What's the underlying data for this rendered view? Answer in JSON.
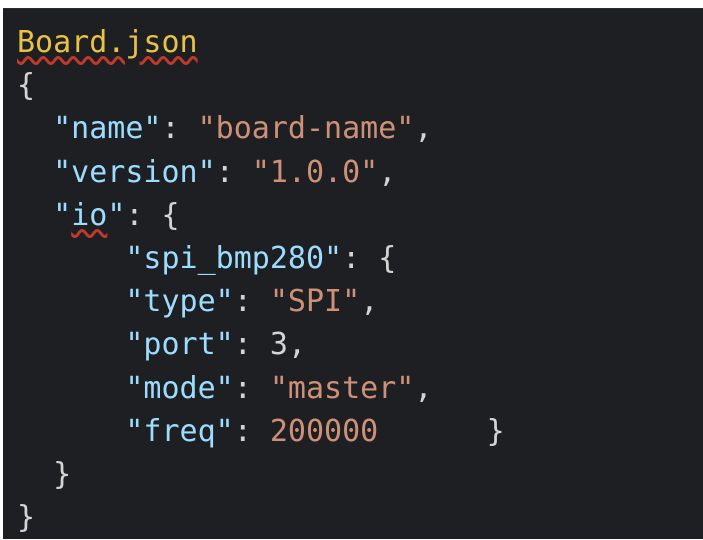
{
  "editor": {
    "filename": "Board.json",
    "lines": {
      "open_brace": "{",
      "name_key": "\"name\"",
      "name_val": "\"board-name\"",
      "version_key": "\"version\"",
      "version_val": "\"1.0.0\"",
      "io_key_q1": "\"",
      "io_key_text": "io",
      "io_key_q2": "\"",
      "spi_key": "\"spi_bmp280\"",
      "type_key": "\"type\"",
      "type_val": "\"SPI\"",
      "port_key": "\"port\"",
      "port_val": "3",
      "mode_key": "\"mode\"",
      "mode_val": "\"master\"",
      "freq_key": "\"freq\"",
      "freq_val": "200000",
      "inner_close": "}",
      "io_close": "}",
      "outer_close": "}"
    }
  },
  "colors": {
    "background": "#1e1f22",
    "key": "#9cdcfe",
    "string": "#ce9178",
    "filename": "#e8c242"
  }
}
